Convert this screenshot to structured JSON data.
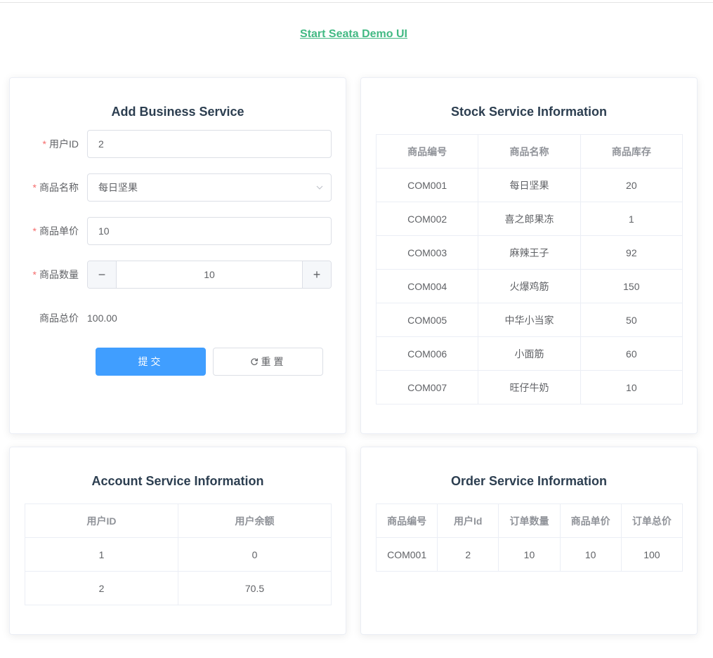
{
  "header": {
    "link_text": "Start Seata Demo UI"
  },
  "business": {
    "title": "Add Business Service",
    "user_id": {
      "label": "用户ID",
      "value": "2"
    },
    "product_name": {
      "label": "商品名称",
      "value": "每日坚果"
    },
    "unit_price": {
      "label": "商品单价",
      "value": "10"
    },
    "quantity": {
      "label": "商品数量",
      "value": "10",
      "minus": "−",
      "plus": "+"
    },
    "total": {
      "label": "商品总价",
      "value": "100.00"
    },
    "submit_label": "提交",
    "reset_label": "重置"
  },
  "stock": {
    "title": "Stock Service Information",
    "headers": [
      "商品编号",
      "商品名称",
      "商品库存"
    ],
    "rows": [
      [
        "COM001",
        "每日坚果",
        "20"
      ],
      [
        "COM002",
        "喜之郎果冻",
        "1"
      ],
      [
        "COM003",
        "麻辣王子",
        "92"
      ],
      [
        "COM004",
        "火爆鸡筋",
        "150"
      ],
      [
        "COM005",
        "中华小当家",
        "50"
      ],
      [
        "COM006",
        "小面筋",
        "60"
      ],
      [
        "COM007",
        "旺仔牛奶",
        "10"
      ]
    ]
  },
  "account": {
    "title": "Account Service Information",
    "headers": [
      "用户ID",
      "用户余额"
    ],
    "rows": [
      [
        "1",
        "0"
      ],
      [
        "2",
        "70.5"
      ]
    ]
  },
  "order": {
    "title": "Order Service Information",
    "headers": [
      "商品编号",
      "用户Id",
      "订单数量",
      "商品单价",
      "订单总价"
    ],
    "rows": [
      [
        "COM001",
        "2",
        "10",
        "10",
        "100"
      ]
    ]
  },
  "colors": {
    "primary": "#409eff",
    "link": "#42b983",
    "required": "#f56c6c"
  }
}
